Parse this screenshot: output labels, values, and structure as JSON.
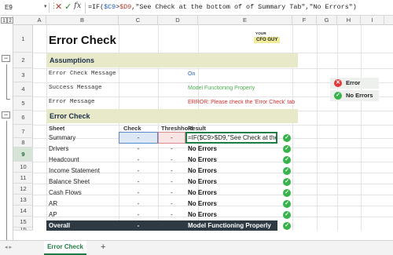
{
  "formula_bar": {
    "name_box": "E9",
    "formula_prefix": "=IF(",
    "ref_check": "$C9",
    "formula_gt": ">",
    "ref_threshold": "$D9",
    "formula_rest": ",\"See Check at the bottom of of Summary Tab\",\"No Errors\")"
  },
  "columns": [
    "A",
    "B",
    "C",
    "D",
    "E",
    "F",
    "G",
    "H",
    "I"
  ],
  "outline_levels": [
    "1",
    "2"
  ],
  "rows": [
    "1",
    "2",
    "3",
    "4",
    "5",
    "6",
    "7",
    "8",
    "9",
    "10",
    "11",
    "12",
    "13",
    "14",
    "15",
    "16",
    "17",
    "18"
  ],
  "title": "Error Check",
  "logo": {
    "line1": "YOUR",
    "line2": "CFO GUY"
  },
  "assumptions": {
    "header": "Assumptions",
    "items": [
      {
        "label": "Error Check Message",
        "value": "On"
      },
      {
        "label": "Success Message",
        "value": "Model Functioning Properly"
      },
      {
        "label": "Error Message",
        "value": "ERROR: Please check the 'Error Check' tab"
      }
    ]
  },
  "error_check": {
    "header": "Error Check",
    "columns": {
      "sheet": "Sheet",
      "check": "Check",
      "threshold": "Threshhold",
      "result": "Result"
    },
    "rows": [
      {
        "sheet": "Summary",
        "check": "-",
        "threshold": "-",
        "result": "=IF($C9>$D9,\"See Check at the"
      },
      {
        "sheet": "Drivers",
        "check": "-",
        "threshold": "-",
        "result": "No Errors"
      },
      {
        "sheet": "Headcount",
        "check": "-",
        "threshold": "-",
        "result": "No Errors"
      },
      {
        "sheet": "Income Statement",
        "check": "-",
        "threshold": "-",
        "result": "No Errors"
      },
      {
        "sheet": "Balance Sheet",
        "check": "-",
        "threshold": "-",
        "result": "No Errors"
      },
      {
        "sheet": "Cash Flows",
        "check": "-",
        "threshold": "-",
        "result": "No Errors"
      },
      {
        "sheet": "AR",
        "check": "-",
        "threshold": "-",
        "result": "No Errors"
      },
      {
        "sheet": "AP",
        "check": "-",
        "threshold": "-",
        "result": "No Errors"
      }
    ],
    "overall": {
      "label": "Overall",
      "check": "-",
      "result": "Model Functioning Properly"
    }
  },
  "legend": {
    "error_label": "Error",
    "ok_label": "No Errors"
  },
  "icons": {
    "ok": "check-circle-icon",
    "error": "x-circle-icon",
    "ok_glyph": "✓",
    "error_glyph": "✕"
  },
  "colors": {
    "ok": "#37b34a",
    "error": "#e23b3b",
    "section": "#e8e9c9",
    "overall": "#2d3a44",
    "active": "#1e7d45"
  },
  "sheet_tabs": {
    "active": "Error Check",
    "add": "+"
  }
}
